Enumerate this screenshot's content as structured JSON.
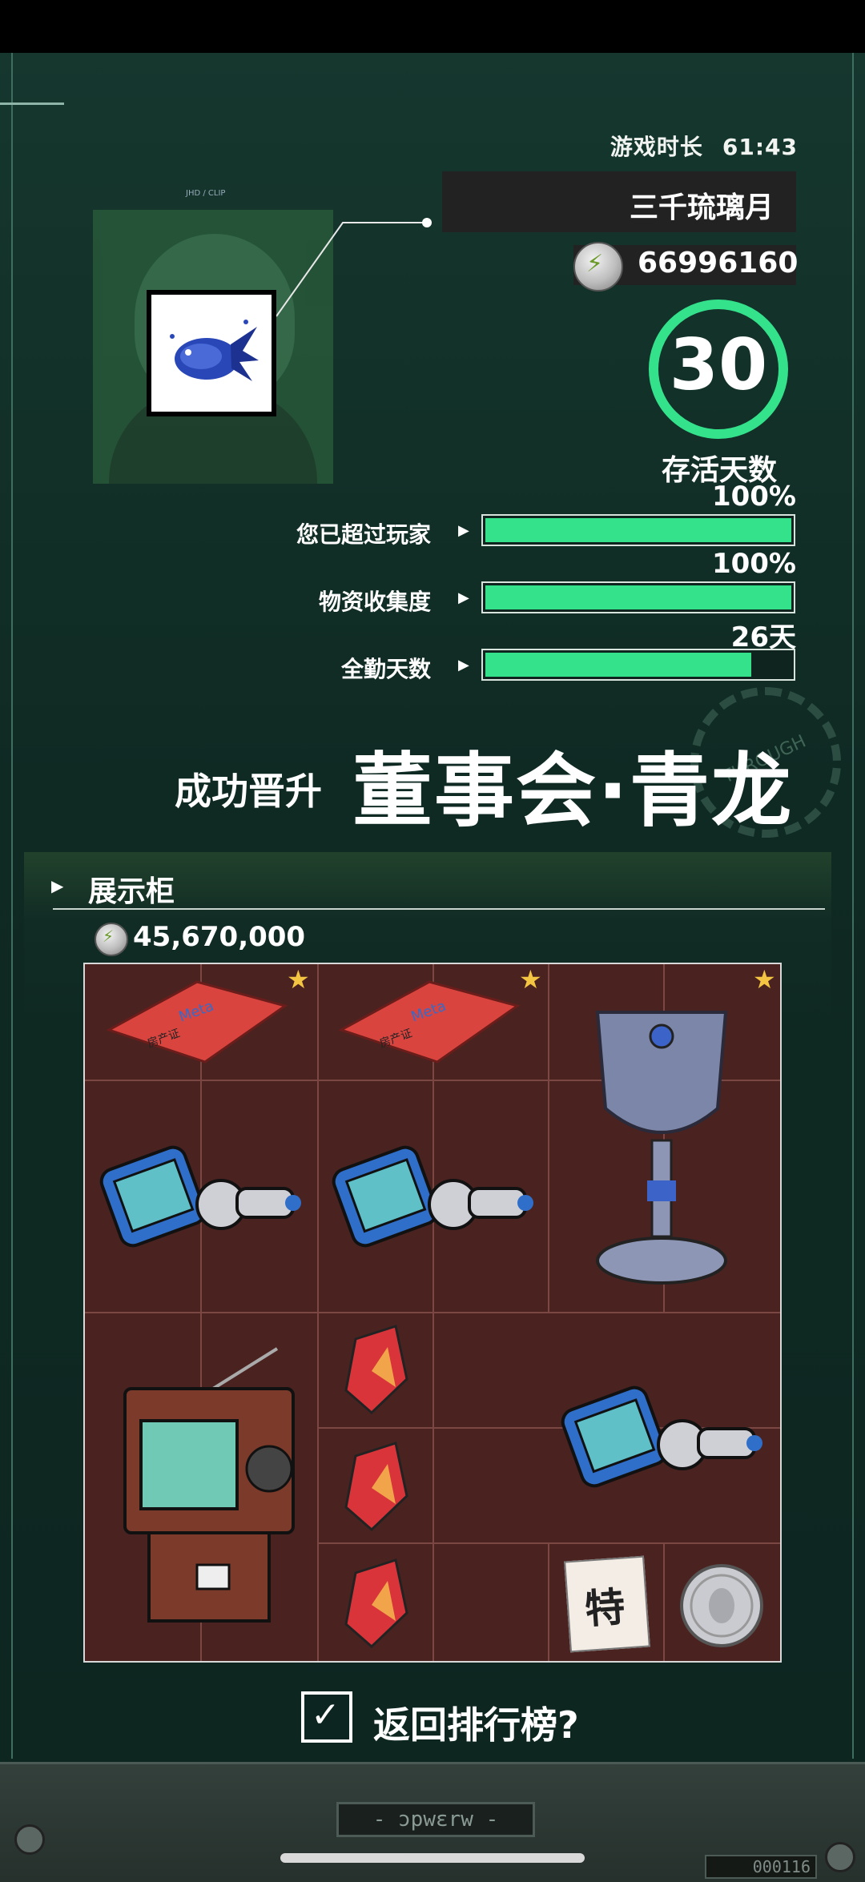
{
  "header": {
    "playtime_label": "游戏时长",
    "playtime_value": "61:43"
  },
  "profile": {
    "name": "三千琉璃月",
    "coins": "66996160",
    "avatar_tag": "JHD / CLIP"
  },
  "survival": {
    "days": "30",
    "label": "存活天数"
  },
  "stats": [
    {
      "label": "您已超过玩家",
      "value": "100%",
      "fill": 1.0
    },
    {
      "label": "物资收集度",
      "value": "100%",
      "fill": 1.0
    },
    {
      "label": "全勤天数",
      "value": "26天",
      "fill": 0.87
    }
  ],
  "promotion": {
    "label": "成功晋升",
    "title": "董事会·青龙"
  },
  "stamp_text": "THROUGH",
  "cabinet": {
    "title": "展示柜",
    "total_value": "45,670,000",
    "items": [
      {
        "name": "property-deed-card",
        "text": "Meta 房产证",
        "starred": true
      },
      {
        "name": "property-deed-card",
        "text": "Meta 房产证",
        "starred": true
      },
      {
        "name": "silver-goblet-trophy",
        "starred": true
      },
      {
        "name": "robot-drone"
      },
      {
        "name": "robot-drone"
      },
      {
        "name": "retro-tv-radio"
      },
      {
        "name": "red-crystal-shard"
      },
      {
        "name": "red-crystal-shard"
      },
      {
        "name": "red-crystal-shard"
      },
      {
        "name": "robot-drone"
      },
      {
        "name": "special-stamp-ticket",
        "text": "特"
      },
      {
        "name": "silver-coin"
      }
    ]
  },
  "footer": {
    "return_label": "返回排行榜?",
    "console_label": "- ɔpwɛrw -",
    "counter": "000116"
  }
}
